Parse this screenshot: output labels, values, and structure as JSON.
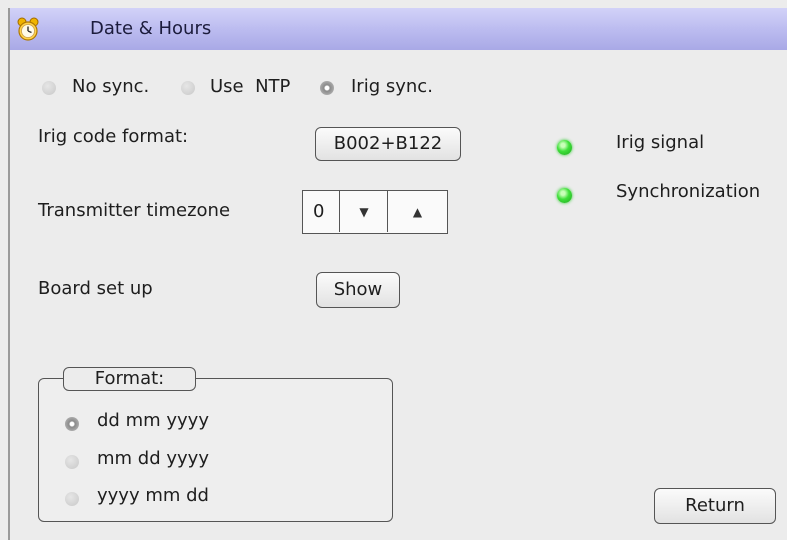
{
  "window": {
    "title": "Date & Hours",
    "icon": "alarm-clock-icon"
  },
  "sync": {
    "options": [
      {
        "label": "No sync.",
        "selected": false
      },
      {
        "label": "Use  NTP",
        "selected": false
      },
      {
        "label": "Irig sync.",
        "selected": true
      }
    ]
  },
  "irig": {
    "label": "Irig code format:",
    "value": "B002+B122"
  },
  "timezone": {
    "label": "Transmitter timezone",
    "value": "0",
    "down_icon": "triangle-down-icon",
    "up_icon": "triangle-up-icon"
  },
  "board": {
    "label": "Board set up",
    "button": "Show"
  },
  "status": {
    "irig_signal": {
      "label": "Irig signal",
      "color": "#2ecc2e"
    },
    "synchronization": {
      "label": "Synchronization",
      "color": "#2ecc2e"
    }
  },
  "format": {
    "legend": "Format:",
    "options": [
      {
        "label": "dd mm yyyy",
        "selected": true
      },
      {
        "label": "mm dd yyyy",
        "selected": false
      },
      {
        "label": "yyyy mm dd",
        "selected": false
      }
    ]
  },
  "footer": {
    "return_label": "Return"
  }
}
